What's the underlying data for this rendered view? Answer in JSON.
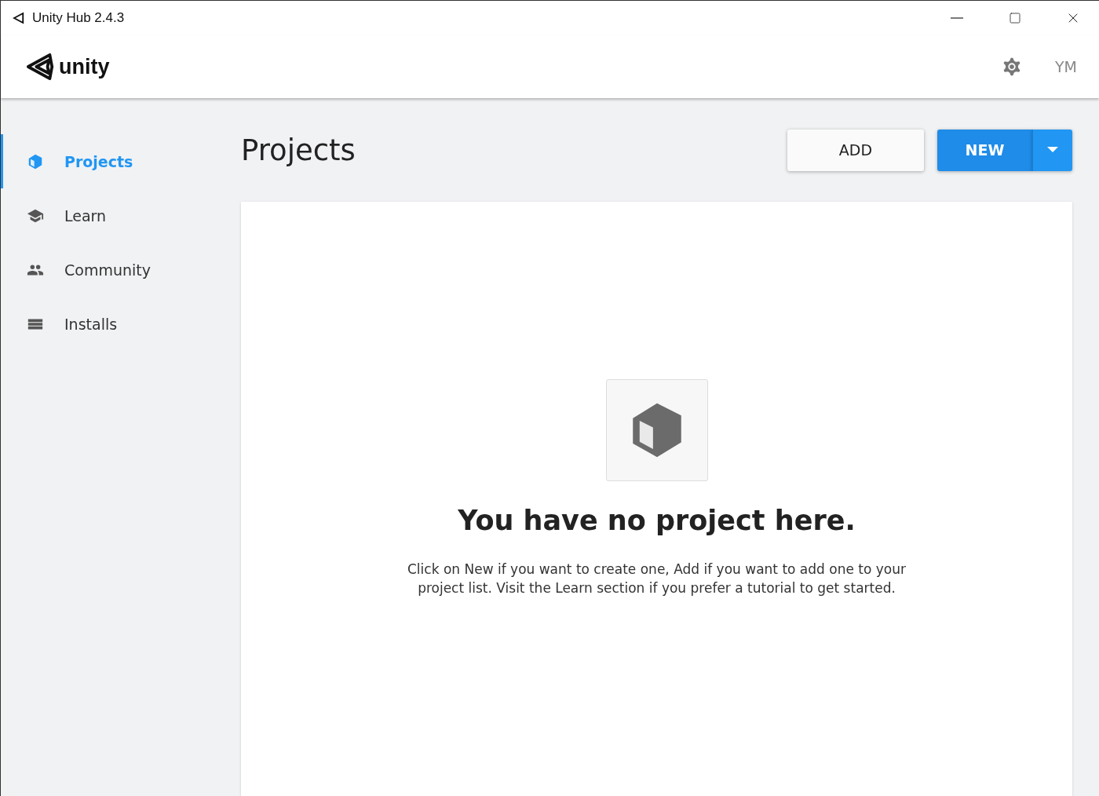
{
  "window": {
    "title": "Unity Hub 2.4.3"
  },
  "header": {
    "logo_text": "unity",
    "user_initials": "YM"
  },
  "sidebar": {
    "items": [
      {
        "label": "Projects",
        "kind": "cube",
        "selected": true
      },
      {
        "label": "Learn",
        "kind": "school",
        "selected": false
      },
      {
        "label": "Community",
        "kind": "people",
        "selected": false
      },
      {
        "label": "Installs",
        "kind": "list",
        "selected": false
      }
    ]
  },
  "main": {
    "title": "Projects",
    "buttons": {
      "add": "ADD",
      "new": "NEW"
    },
    "empty_state": {
      "heading": "You have no project here.",
      "message": "Click on New if you want to create one, Add if you want to add one to your project list. Visit the Learn section if you prefer a tutorial to get started."
    }
  }
}
